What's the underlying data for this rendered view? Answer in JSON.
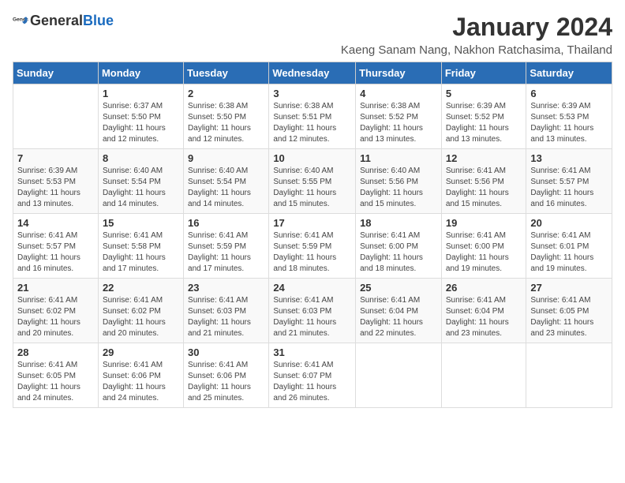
{
  "header": {
    "logo_general": "General",
    "logo_blue": "Blue",
    "main_title": "January 2024",
    "subtitle": "Kaeng Sanam Nang, Nakhon Ratchasima, Thailand"
  },
  "weekdays": [
    "Sunday",
    "Monday",
    "Tuesday",
    "Wednesday",
    "Thursday",
    "Friday",
    "Saturday"
  ],
  "weeks": [
    [
      {
        "day": "",
        "sunrise": "",
        "sunset": "",
        "daylight": ""
      },
      {
        "day": "1",
        "sunrise": "Sunrise: 6:37 AM",
        "sunset": "Sunset: 5:50 PM",
        "daylight": "Daylight: 11 hours and 12 minutes."
      },
      {
        "day": "2",
        "sunrise": "Sunrise: 6:38 AM",
        "sunset": "Sunset: 5:50 PM",
        "daylight": "Daylight: 11 hours and 12 minutes."
      },
      {
        "day": "3",
        "sunrise": "Sunrise: 6:38 AM",
        "sunset": "Sunset: 5:51 PM",
        "daylight": "Daylight: 11 hours and 12 minutes."
      },
      {
        "day": "4",
        "sunrise": "Sunrise: 6:38 AM",
        "sunset": "Sunset: 5:52 PM",
        "daylight": "Daylight: 11 hours and 13 minutes."
      },
      {
        "day": "5",
        "sunrise": "Sunrise: 6:39 AM",
        "sunset": "Sunset: 5:52 PM",
        "daylight": "Daylight: 11 hours and 13 minutes."
      },
      {
        "day": "6",
        "sunrise": "Sunrise: 6:39 AM",
        "sunset": "Sunset: 5:53 PM",
        "daylight": "Daylight: 11 hours and 13 minutes."
      }
    ],
    [
      {
        "day": "7",
        "sunrise": "Sunrise: 6:39 AM",
        "sunset": "Sunset: 5:53 PM",
        "daylight": "Daylight: 11 hours and 13 minutes."
      },
      {
        "day": "8",
        "sunrise": "Sunrise: 6:40 AM",
        "sunset": "Sunset: 5:54 PM",
        "daylight": "Daylight: 11 hours and 14 minutes."
      },
      {
        "day": "9",
        "sunrise": "Sunrise: 6:40 AM",
        "sunset": "Sunset: 5:54 PM",
        "daylight": "Daylight: 11 hours and 14 minutes."
      },
      {
        "day": "10",
        "sunrise": "Sunrise: 6:40 AM",
        "sunset": "Sunset: 5:55 PM",
        "daylight": "Daylight: 11 hours and 15 minutes."
      },
      {
        "day": "11",
        "sunrise": "Sunrise: 6:40 AM",
        "sunset": "Sunset: 5:56 PM",
        "daylight": "Daylight: 11 hours and 15 minutes."
      },
      {
        "day": "12",
        "sunrise": "Sunrise: 6:41 AM",
        "sunset": "Sunset: 5:56 PM",
        "daylight": "Daylight: 11 hours and 15 minutes."
      },
      {
        "day": "13",
        "sunrise": "Sunrise: 6:41 AM",
        "sunset": "Sunset: 5:57 PM",
        "daylight": "Daylight: 11 hours and 16 minutes."
      }
    ],
    [
      {
        "day": "14",
        "sunrise": "Sunrise: 6:41 AM",
        "sunset": "Sunset: 5:57 PM",
        "daylight": "Daylight: 11 hours and 16 minutes."
      },
      {
        "day": "15",
        "sunrise": "Sunrise: 6:41 AM",
        "sunset": "Sunset: 5:58 PM",
        "daylight": "Daylight: 11 hours and 17 minutes."
      },
      {
        "day": "16",
        "sunrise": "Sunrise: 6:41 AM",
        "sunset": "Sunset: 5:59 PM",
        "daylight": "Daylight: 11 hours and 17 minutes."
      },
      {
        "day": "17",
        "sunrise": "Sunrise: 6:41 AM",
        "sunset": "Sunset: 5:59 PM",
        "daylight": "Daylight: 11 hours and 18 minutes."
      },
      {
        "day": "18",
        "sunrise": "Sunrise: 6:41 AM",
        "sunset": "Sunset: 6:00 PM",
        "daylight": "Daylight: 11 hours and 18 minutes."
      },
      {
        "day": "19",
        "sunrise": "Sunrise: 6:41 AM",
        "sunset": "Sunset: 6:00 PM",
        "daylight": "Daylight: 11 hours and 19 minutes."
      },
      {
        "day": "20",
        "sunrise": "Sunrise: 6:41 AM",
        "sunset": "Sunset: 6:01 PM",
        "daylight": "Daylight: 11 hours and 19 minutes."
      }
    ],
    [
      {
        "day": "21",
        "sunrise": "Sunrise: 6:41 AM",
        "sunset": "Sunset: 6:02 PM",
        "daylight": "Daylight: 11 hours and 20 minutes."
      },
      {
        "day": "22",
        "sunrise": "Sunrise: 6:41 AM",
        "sunset": "Sunset: 6:02 PM",
        "daylight": "Daylight: 11 hours and 20 minutes."
      },
      {
        "day": "23",
        "sunrise": "Sunrise: 6:41 AM",
        "sunset": "Sunset: 6:03 PM",
        "daylight": "Daylight: 11 hours and 21 minutes."
      },
      {
        "day": "24",
        "sunrise": "Sunrise: 6:41 AM",
        "sunset": "Sunset: 6:03 PM",
        "daylight": "Daylight: 11 hours and 21 minutes."
      },
      {
        "day": "25",
        "sunrise": "Sunrise: 6:41 AM",
        "sunset": "Sunset: 6:04 PM",
        "daylight": "Daylight: 11 hours and 22 minutes."
      },
      {
        "day": "26",
        "sunrise": "Sunrise: 6:41 AM",
        "sunset": "Sunset: 6:04 PM",
        "daylight": "Daylight: 11 hours and 23 minutes."
      },
      {
        "day": "27",
        "sunrise": "Sunrise: 6:41 AM",
        "sunset": "Sunset: 6:05 PM",
        "daylight": "Daylight: 11 hours and 23 minutes."
      }
    ],
    [
      {
        "day": "28",
        "sunrise": "Sunrise: 6:41 AM",
        "sunset": "Sunset: 6:05 PM",
        "daylight": "Daylight: 11 hours and 24 minutes."
      },
      {
        "day": "29",
        "sunrise": "Sunrise: 6:41 AM",
        "sunset": "Sunset: 6:06 PM",
        "daylight": "Daylight: 11 hours and 24 minutes."
      },
      {
        "day": "30",
        "sunrise": "Sunrise: 6:41 AM",
        "sunset": "Sunset: 6:06 PM",
        "daylight": "Daylight: 11 hours and 25 minutes."
      },
      {
        "day": "31",
        "sunrise": "Sunrise: 6:41 AM",
        "sunset": "Sunset: 6:07 PM",
        "daylight": "Daylight: 11 hours and 26 minutes."
      },
      {
        "day": "",
        "sunrise": "",
        "sunset": "",
        "daylight": ""
      },
      {
        "day": "",
        "sunrise": "",
        "sunset": "",
        "daylight": ""
      },
      {
        "day": "",
        "sunrise": "",
        "sunset": "",
        "daylight": ""
      }
    ]
  ]
}
